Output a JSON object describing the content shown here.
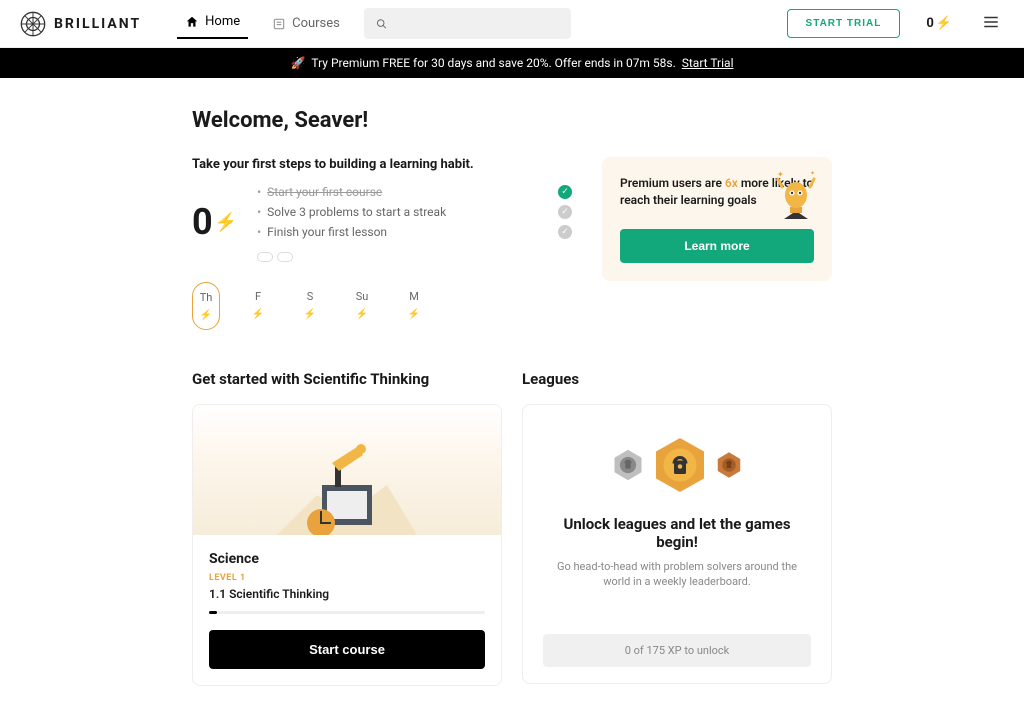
{
  "header": {
    "brand": "BRILLIANT",
    "nav": {
      "home": "Home",
      "courses": "Courses"
    },
    "search_placeholder": "",
    "trial_button": "START TRIAL",
    "points": "0"
  },
  "promo_banner": {
    "text_prefix": "Try Premium FREE for 30 days and save 20%. Offer ends in 07m 58s.",
    "cta": "Start Trial"
  },
  "welcome": "Welcome, Seaver!",
  "streak_count": "0",
  "steps": {
    "heading": "Take your first steps to building a learning habit.",
    "items": [
      {
        "label": "Start your first course",
        "done": true
      },
      {
        "label": "Solve 3 problems to start a streak",
        "done": false
      },
      {
        "label": "Finish your first lesson",
        "done": false
      }
    ]
  },
  "promo_card": {
    "line1": "Premium users are ",
    "highlight": "6x",
    "line2": " more likely to reach their learning goals",
    "button": "Learn more"
  },
  "days": [
    "Th",
    "F",
    "S",
    "Su",
    "M"
  ],
  "sections": {
    "course_title": "Get started with Scientific Thinking",
    "leagues_title": "Leagues"
  },
  "course_card": {
    "subject": "Science",
    "level": "LEVEL 1",
    "lesson": "1.1 Scientific Thinking",
    "button": "Start course"
  },
  "leagues_card": {
    "title": "Unlock leagues and let the games begin!",
    "subtitle": "Go head-to-head with problem solvers around the world in a weekly leaderboard.",
    "xp": "0 of 175 XP to unlock"
  }
}
